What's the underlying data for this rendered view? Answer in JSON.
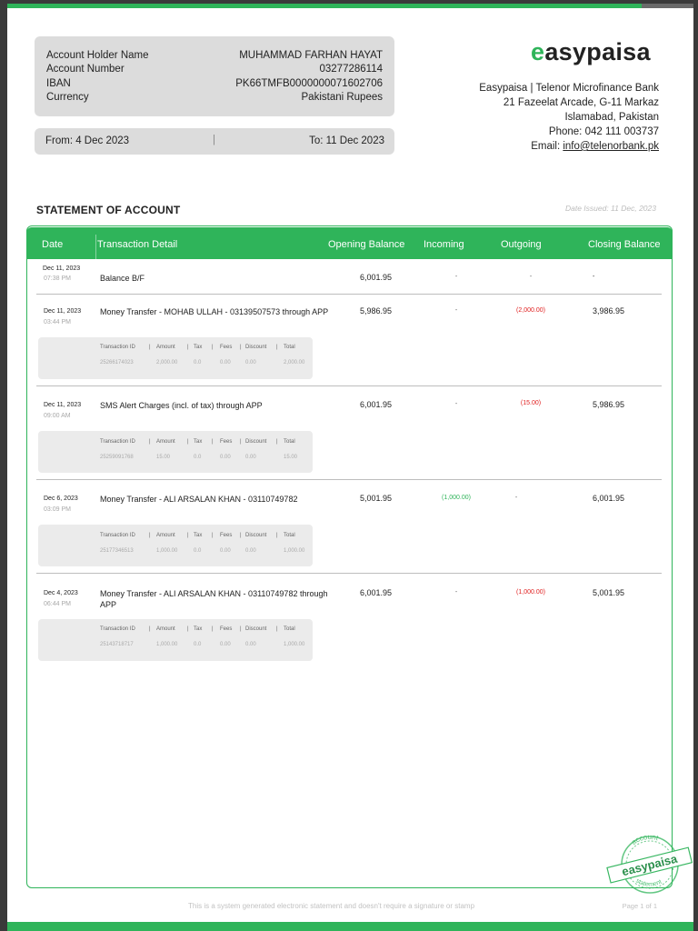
{
  "account": {
    "holder_label": "Account Holder Name",
    "holder_value": "MUHAMMAD FARHAN HAYAT",
    "number_label": "Account Number",
    "number_value": "03277286114",
    "iban_label": "IBAN",
    "iban_value": "PK66TMFB0000000071602706",
    "currency_label": "Currency",
    "currency_value": "Pakistani Rupees"
  },
  "period": {
    "from": "From: 4 Dec 2023",
    "separator": "|",
    "to": "To: 11 Dec 2023"
  },
  "brand": {
    "logo_e": "e",
    "logo_rest": "asypaisa",
    "accent_color": "#2fb45a",
    "bank_line": "Easypaisa | Telenor Microfinance Bank",
    "address1": "21 Fazeelat Arcade, G-11 Markaz",
    "address2": "Islamabad, Pakistan",
    "phone": "Phone: 042 111 003737",
    "email_label": "Email: ",
    "email": "info@telenorbank.pk"
  },
  "statement": {
    "title": "STATEMENT OF ACCOUNT",
    "date_issued": "Date Issued: 11 Dec, 2023"
  },
  "table": {
    "headers": {
      "date": "Date",
      "detail": "Transaction Detail",
      "opening": "Opening Balance",
      "incoming": "Incoming",
      "outgoing": "Outgoing",
      "closing": "Closing Balance"
    },
    "sub_headers": {
      "txn_id": "Transaction ID",
      "amount": "Amount",
      "tax": "Tax",
      "fees": "Fees",
      "discount": "Discount",
      "total": "Total",
      "divider": "|"
    },
    "rows": [
      {
        "date": "Dec 11, 2023",
        "time": "07:38 PM",
        "detail": "Balance B/F",
        "opening": "6,001.95",
        "incoming": "-",
        "outgoing": "-",
        "closing": "-"
      },
      {
        "date": "Dec 11, 2023",
        "time": "03:44 PM",
        "detail": "Money Transfer - MOHAB ULLAH - 03139507573 through APP",
        "opening": "5,986.95",
        "incoming": "-",
        "outgoing": "(2,000.00)",
        "closing": "3,986.95",
        "sub": {
          "txn_id": "25266174023",
          "amount": "2,000.00",
          "tax": "0.0",
          "fees": "0.00",
          "discount": "0.00",
          "total": "2,000.00"
        }
      },
      {
        "date": "Dec 11, 2023",
        "time": "09:00 AM",
        "detail": "SMS Alert Charges (incl. of tax) through APP",
        "opening": "6,001.95",
        "incoming": "-",
        "outgoing": "(15.00)",
        "closing": "5,986.95",
        "sub": {
          "txn_id": "25259091768",
          "amount": "15.00",
          "tax": "0.0",
          "fees": "0.00",
          "discount": "0.00",
          "total": "15.00"
        }
      },
      {
        "date": "Dec 6, 2023",
        "time": "03:09 PM",
        "detail": "Money Transfer - ALI ARSALAN KHAN - 03110749782",
        "opening": "5,001.95",
        "incoming": "(1,000.00)",
        "outgoing": "-",
        "closing": "6,001.95",
        "sub": {
          "txn_id": "25177346513",
          "amount": "1,000.00",
          "tax": "0.0",
          "fees": "0.00",
          "discount": "0.00",
          "total": "1,000.00"
        }
      },
      {
        "date": "Dec 4, 2023",
        "time": "06:44 PM",
        "detail": "Money Transfer - ALI ARSALAN KHAN - 03110749782 through APP",
        "opening": "6,001.95",
        "incoming": "-",
        "outgoing": "(1,000.00)",
        "closing": "5,001.95",
        "sub": {
          "txn_id": "25143718717",
          "amount": "1,000.00",
          "tax": "0.0",
          "fees": "0.00",
          "discount": "0.00",
          "total": "1,000.00"
        }
      }
    ]
  },
  "stamp": {
    "top_text": "account",
    "middle_text": "easypaisa",
    "bottom_text": "statement"
  },
  "footer": {
    "note": "This is a system generated electronic statement and doesn't require a signature or stamp",
    "page": "Page 1 of 1"
  }
}
